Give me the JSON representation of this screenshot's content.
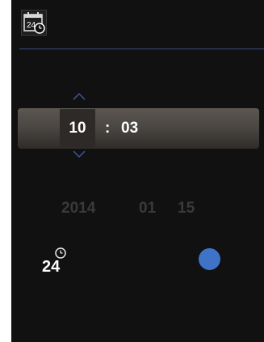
{
  "header": {
    "icon": "calendar-clock-icon",
    "icon_text": "24",
    "divider_color": "#3b4f8a"
  },
  "time": {
    "hour": "10",
    "separator": ":",
    "minute": "03"
  },
  "date": {
    "year": "2014",
    "month": "01",
    "day": "15"
  },
  "format": {
    "icon": "24-hour-format-icon",
    "icon_text": "24",
    "toggle_color": "#3f73c8"
  },
  "colors": {
    "background": "#111111",
    "accent": "#3f73c8",
    "arrow": "#3b4f8a",
    "dim_text": "#3a3a3a"
  }
}
